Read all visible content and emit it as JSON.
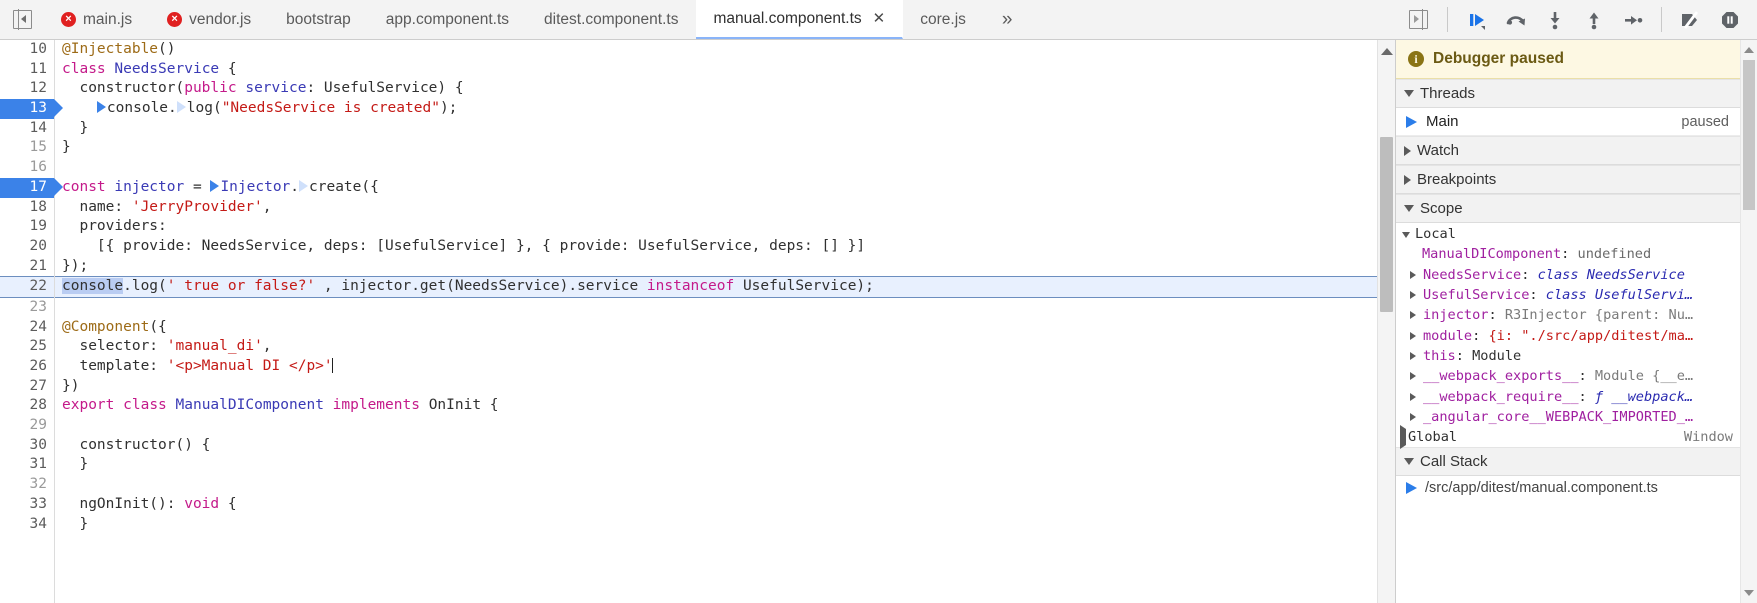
{
  "window": {
    "title": "Chrome DevTools — Sources"
  },
  "topbar": {
    "panel_toggle_icon": "panel-collapse-icon",
    "tabs": [
      {
        "label": "main.js",
        "error": true,
        "error_glyph": "×",
        "active": false,
        "closable": false
      },
      {
        "label": "vendor.js",
        "error": true,
        "error_glyph": "×",
        "active": false,
        "closable": false
      },
      {
        "label": "bootstrap",
        "error": false,
        "active": false,
        "closable": false
      },
      {
        "label": "app.component.ts",
        "error": false,
        "active": false,
        "closable": false
      },
      {
        "label": "ditest.component.ts",
        "error": false,
        "active": false,
        "closable": false
      },
      {
        "label": "manual.component.ts",
        "error": false,
        "active": true,
        "closable": true,
        "close_glyph": "✕"
      },
      {
        "label": "core.js",
        "error": false,
        "active": false,
        "closable": false
      }
    ],
    "more_tabs_glyph": "»",
    "show_navigator_icon": "show-navigator-icon",
    "debug_buttons": [
      {
        "name": "resume-script-execution",
        "glyph": "resume"
      },
      {
        "name": "step-over-next-function-call",
        "glyph": "step-over"
      },
      {
        "name": "step-into-next-function-call",
        "glyph": "step-into"
      },
      {
        "name": "step-out-of-current-function",
        "glyph": "step-out"
      },
      {
        "name": "step",
        "glyph": "step"
      },
      {
        "name": "deactivate-breakpoints",
        "glyph": "deactivate-breakpoints"
      },
      {
        "name": "pause-on-exceptions",
        "glyph": "pause-on-exceptions"
      }
    ]
  },
  "editor": {
    "first_visible_line": 10,
    "lines": [
      {
        "n": 10,
        "breakpoint": false,
        "executing": false,
        "dim": false
      },
      {
        "n": 11,
        "breakpoint": false,
        "executing": false,
        "dim": false
      },
      {
        "n": 12,
        "breakpoint": false,
        "executing": false,
        "dim": false
      },
      {
        "n": 13,
        "breakpoint": true,
        "executing": false,
        "dim": false
      },
      {
        "n": 14,
        "breakpoint": false,
        "executing": false,
        "dim": false
      },
      {
        "n": 15,
        "breakpoint": false,
        "executing": false,
        "dim": true
      },
      {
        "n": 16,
        "breakpoint": false,
        "executing": false,
        "dim": true
      },
      {
        "n": 17,
        "breakpoint": true,
        "executing": false,
        "dim": false
      },
      {
        "n": 18,
        "breakpoint": false,
        "executing": false,
        "dim": false
      },
      {
        "n": 19,
        "breakpoint": false,
        "executing": false,
        "dim": false
      },
      {
        "n": 20,
        "breakpoint": false,
        "executing": false,
        "dim": false
      },
      {
        "n": 21,
        "breakpoint": false,
        "executing": false,
        "dim": false
      },
      {
        "n": 22,
        "breakpoint": false,
        "executing": true,
        "dim": false
      },
      {
        "n": 23,
        "breakpoint": false,
        "executing": false,
        "dim": true
      },
      {
        "n": 24,
        "breakpoint": false,
        "executing": false,
        "dim": false
      },
      {
        "n": 25,
        "breakpoint": false,
        "executing": false,
        "dim": false
      },
      {
        "n": 26,
        "breakpoint": false,
        "executing": false,
        "dim": false
      },
      {
        "n": 27,
        "breakpoint": false,
        "executing": false,
        "dim": false
      },
      {
        "n": 28,
        "breakpoint": false,
        "executing": false,
        "dim": false
      },
      {
        "n": 29,
        "breakpoint": false,
        "executing": false,
        "dim": true
      },
      {
        "n": 30,
        "breakpoint": false,
        "executing": false,
        "dim": false
      },
      {
        "n": 31,
        "breakpoint": false,
        "executing": false,
        "dim": false
      },
      {
        "n": 32,
        "breakpoint": false,
        "executing": false,
        "dim": true
      },
      {
        "n": 33,
        "breakpoint": false,
        "executing": false,
        "dim": false
      },
      {
        "n": 34,
        "breakpoint": false,
        "executing": false,
        "dim": false
      }
    ],
    "source_text": [
      "@Injectable()",
      "class NeedsService {",
      "  constructor(public service: UsefulService) {",
      "    console.log(\"NeedsService is created\");",
      "  }",
      "}",
      "",
      "const injector = Injector.create({",
      "  name: 'JerryProvider',",
      "  providers:",
      "    [{ provide: NeedsService, deps: [UsefulService] }, { provide: UsefulService, deps: [] }]",
      "});",
      "console.log(' true or false?' , injector.get(NeedsService).service instanceof UsefulService);",
      "",
      "@Component({",
      "  selector: 'manual_di',",
      "  template: '<p>Manual DI </p>'",
      "})",
      "export class ManualDIComponent implements OnInit {",
      "",
      "  constructor() {",
      "  }",
      "",
      "  ngOnInit(): void {",
      "  }"
    ]
  },
  "sidebar": {
    "paused_banner": {
      "text": "Debugger paused",
      "icon": "info-icon"
    },
    "sections": {
      "threads": {
        "label": "Threads",
        "expanded": true
      },
      "watch": {
        "label": "Watch",
        "expanded": false
      },
      "breakpoints": {
        "label": "Breakpoints",
        "expanded": false
      },
      "scope": {
        "label": "Scope",
        "expanded": true
      },
      "call_stack": {
        "label": "Call Stack",
        "expanded": true
      }
    },
    "thread": {
      "name": "Main",
      "status": "paused"
    },
    "scope": {
      "local_label": "Local",
      "entries": [
        {
          "name": "ManualDIComponent",
          "sep": ":",
          "value": "undefined",
          "value_kind": "undefined",
          "expandable": false
        },
        {
          "name": "NeedsService",
          "sep": ":",
          "value": "class NeedsService",
          "value_kind": "class",
          "expandable": true
        },
        {
          "name": "UsefulService",
          "sep": ":",
          "value": "class UsefulServi…",
          "value_kind": "class",
          "expandable": true
        },
        {
          "name": "injector",
          "sep": ":",
          "value": "R3Injector {parent: Nu…",
          "value_kind": "object",
          "expandable": true
        },
        {
          "name": "module",
          "sep": ":",
          "value": "{i: \"./src/app/ditest/ma…",
          "value_kind": "object-string",
          "expandable": true
        },
        {
          "name": "this",
          "sep": ":",
          "value": "Module",
          "value_kind": "plain",
          "expandable": true
        },
        {
          "name": "__webpack_exports__",
          "sep": ":",
          "value": "Module {__e…",
          "value_kind": "object",
          "expandable": true
        },
        {
          "name": "__webpack_require__",
          "sep": ":",
          "value": "ƒ __webpack…",
          "value_kind": "function",
          "expandable": true
        },
        {
          "name": "_angular_core__WEBPACK_IMPORTED_…",
          "sep": "",
          "value": "",
          "value_kind": "plain",
          "expandable": true
        }
      ],
      "global_label": "Global",
      "global_value": "Window"
    },
    "call_stack": {
      "items": [
        {
          "label": "/src/app/ditest/manual.component.ts",
          "active": true
        }
      ]
    }
  },
  "colors": {
    "accent_blue": "#3b82e8",
    "breakpoint_blue": "#3b82e8",
    "exec_row_bg": "#e8f0fe",
    "paused_banner_bg": "#fdf8e3",
    "error_red": "#e02020",
    "string_red": "#c41a16",
    "keyword_magenta": "#c41a8a",
    "type_blue": "#3a3ab5",
    "decorator_gold": "#9d6b17",
    "property_purple": "#a020a0"
  }
}
